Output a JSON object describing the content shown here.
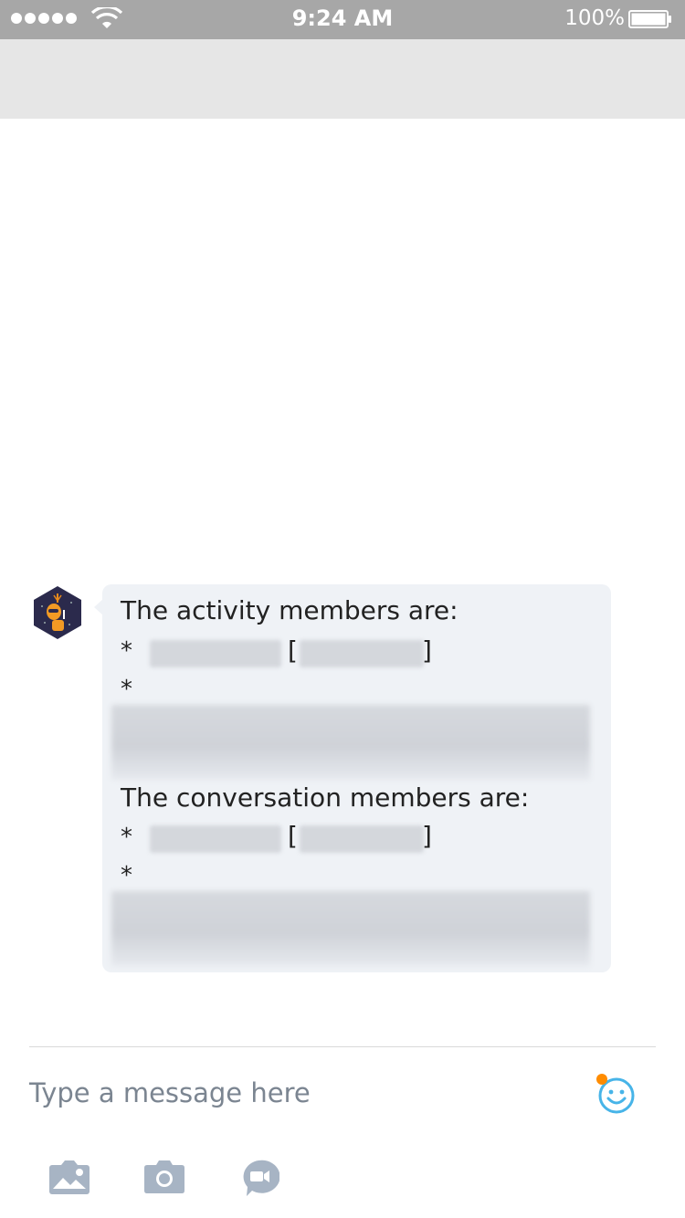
{
  "status_bar": {
    "time": "9:24 AM",
    "battery_percent": "100%",
    "signal_bars": 5,
    "battery_level": 1.0
  },
  "chat": {
    "bot_avatar_icon": "bot-avatar-icon",
    "message": {
      "activity_heading": "The activity members are:",
      "activity_bullet_1_star": "*",
      "activity_bullet_2_star": "*",
      "conversation_heading": "The conversation members are:",
      "conversation_bullet_1_star": "*",
      "conversation_bullet_2_star": "*",
      "open_bracket": "[",
      "close_bracket": "]"
    }
  },
  "composer": {
    "placeholder": "Type a message here",
    "emoji_icon": "emoji-icon",
    "toolbar": [
      "image-icon",
      "camera-icon",
      "video-call-icon"
    ]
  },
  "colors": {
    "status_bar_bg": "#a7a7a7",
    "nav_bar_bg": "#e6e6e6",
    "bubble_bg": "#eff2f6",
    "accent_blue": "#47b4e8",
    "notify_orange": "#ff8c00",
    "icon_gray": "#a7b4c4"
  }
}
